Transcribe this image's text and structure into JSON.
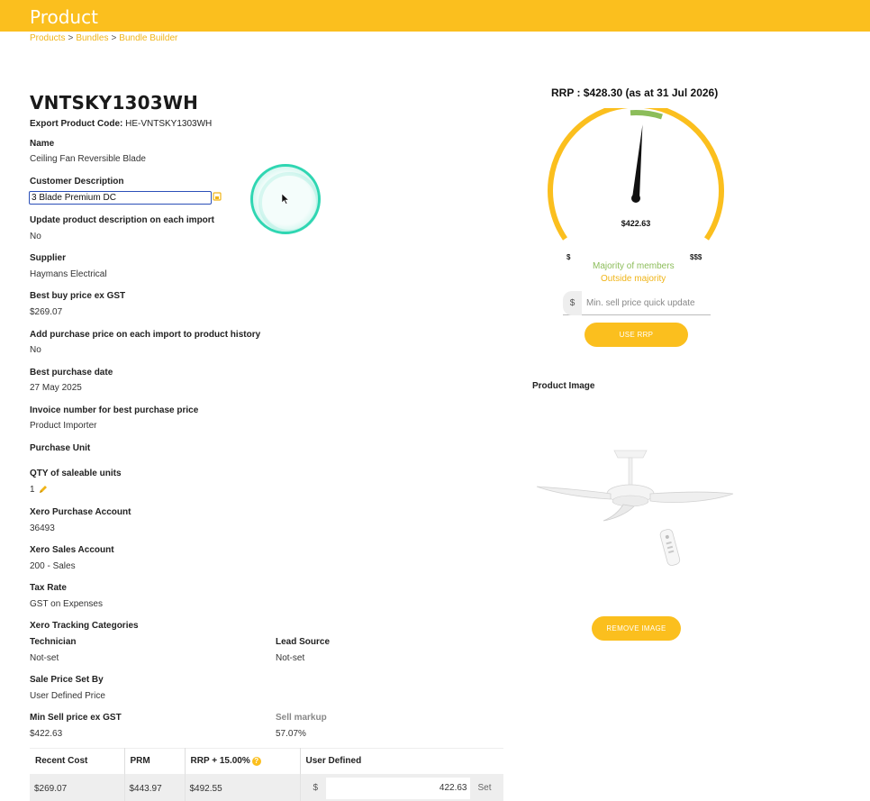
{
  "header": {
    "title": "Product"
  },
  "breadcrumb": {
    "items": [
      "Products",
      "Bundles",
      "Bundle Builder"
    ],
    "separator": ">"
  },
  "product": {
    "sku": "VNTSKY1303WH",
    "export_label": "Export Product Code:",
    "export_value": "HE-VNTSKY1303WH",
    "name_label": "Name",
    "name_value": "Ceiling Fan Reversible Blade",
    "cust_desc_label": "Customer Description",
    "cust_desc_value": "3 Blade Premium DC",
    "update_desc_label": "Update product description on each import",
    "update_desc_value": "No",
    "supplier_label": "Supplier",
    "supplier_value": "Haymans Electrical",
    "best_buy_label": "Best buy price ex GST",
    "best_buy_value": "$269.07",
    "add_purchase_label": "Add purchase price on each import to product history",
    "add_purchase_value": "No",
    "best_purchase_date_label": "Best purchase date",
    "best_purchase_date_value": "27 May 2025",
    "invoice_label": "Invoice number for best purchase price",
    "invoice_value": "Product Importer",
    "purchase_unit_label": "Purchase Unit",
    "qty_label": "QTY of saleable units",
    "qty_value": "1",
    "xero_purchase_label": "Xero Purchase Account",
    "xero_purchase_value": "36493",
    "xero_sales_label": "Xero Sales Account",
    "xero_sales_value": "200 - Sales",
    "tax_label": "Tax Rate",
    "tax_value": "GST on Expenses",
    "tracking_label": "Xero Tracking Categories",
    "technician_label": "Technician",
    "technician_value": "Not-set",
    "lead_label": "Lead Source",
    "lead_value": "Not-set",
    "sale_price_label": "Sale Price Set By",
    "sale_price_value": "User Defined Price",
    "min_sell_label": "Min Sell price ex GST",
    "min_sell_value": "$422.63",
    "markup_label": "Sell markup",
    "markup_value": "57.07%"
  },
  "price_table": {
    "headers": [
      "Recent Cost",
      "PRM",
      "RRP + 15.00%",
      "User Defined"
    ],
    "row": [
      "$269.07",
      "$443.97",
      "$492.55"
    ],
    "user_defined_currency": "$",
    "user_defined_value": "422.63",
    "set_label": "Set"
  },
  "rrp": {
    "title": "RRP : $428.30 (as at 31 Jul 2026)",
    "gauge_value": "$422.63",
    "gauge_min_label": "$",
    "gauge_max_label": "$$$",
    "needle_fraction": 0.52,
    "majority_label": "Majority of members",
    "outside_label": "Outside majority",
    "colors": {
      "majority": "#8cbd5a",
      "outside": "#fbbf1e",
      "needle": "#111111"
    }
  },
  "quick_update": {
    "currency": "$",
    "placeholder": "Min. sell price quick update",
    "use_rrp_label": "USE RRP"
  },
  "product_image": {
    "label": "Product Image",
    "remove_label": "REMOVE IMAGE"
  },
  "colors": {
    "accent": "#fbbf1e",
    "input_border": "#2b4fb8",
    "cursor_ring": "#2fd6b2"
  }
}
